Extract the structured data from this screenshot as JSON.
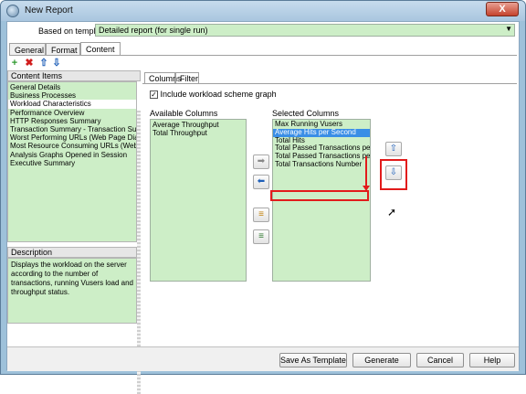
{
  "window": {
    "title": "New Report",
    "close_glyph": "X"
  },
  "template": {
    "label": "Based on template",
    "value": "Detailed report (for single run)"
  },
  "tabs": [
    {
      "label": "General"
    },
    {
      "label": "Format"
    },
    {
      "label": "Content"
    }
  ],
  "toolbar": {
    "icons": [
      "add-icon",
      "delete-icon",
      "move-up-icon",
      "move-down-icon"
    ]
  },
  "content_items": {
    "header": "Content Items",
    "items": [
      "General Details",
      "Business Processes",
      "Workload Characteristics",
      "Performance Overview",
      "HTTP Responses Summary",
      "Transaction Summary - Transaction Sum...",
      "Worst Performing URLs (Web Page Diag...",
      "Most Resource Consuming URLs (Web P...",
      "Analysis Graphs Opened in Session",
      "Executive Summary"
    ],
    "selected": "Workload Characteristics"
  },
  "description": {
    "header": "Description",
    "text": "Displays the workload on the server according to the number of transactions, running Vusers load and throughput status."
  },
  "subtabs": [
    {
      "label": "Columns"
    },
    {
      "label": "Filter"
    }
  ],
  "checkbox": {
    "label": "Include workload scheme graph",
    "checked": true
  },
  "available": {
    "label": "Available Columns",
    "items": [
      "Average Throughput",
      "Total Throughput"
    ]
  },
  "selected_columns": {
    "label": "Selected Columns",
    "items": [
      "Max Running Vusers",
      "Average Hits per Second",
      "Total Hits",
      "Total Passed Transactions per Se",
      "Total Passed Transactions per Mi",
      "Total Transactions Number"
    ],
    "highlighted": "Average Hits per Second"
  },
  "buttons": {
    "save_template": "Save As Template",
    "generate": "Generate",
    "cancel": "Cancel",
    "help": "Help"
  }
}
